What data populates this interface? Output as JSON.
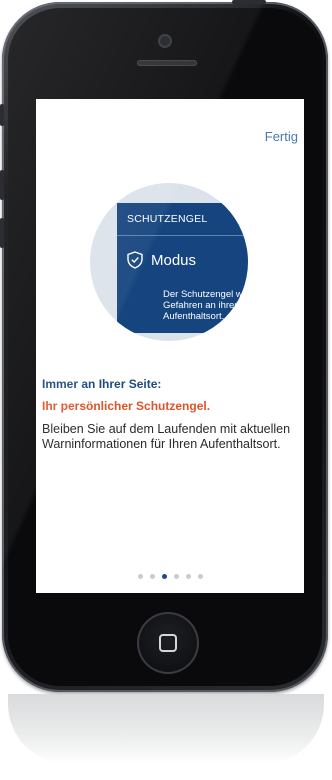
{
  "screen": {
    "done_label": "Fertig",
    "card": {
      "header": "SCHUTZENGEL",
      "mode_label": "Modus",
      "description": "Der Schutzengel wa\nGefahren an ihrem\nAufenthaltsort."
    },
    "headline": "Immer an Ihrer Seite:",
    "subheadline": "Ihr persönlicher Schutzengel.",
    "body": "Bleiben Sie auf dem Laufenden mit aktuellen Warninformationen für Ihren Aufenthaltsort.",
    "pager": {
      "count": 6,
      "active_index": 2
    }
  },
  "colors": {
    "accent_blue": "#1f4b7e",
    "accent_red": "#e0542a",
    "link": "#4a79ad"
  },
  "icons": [
    "shield-check-icon",
    "home-button-icon"
  ]
}
